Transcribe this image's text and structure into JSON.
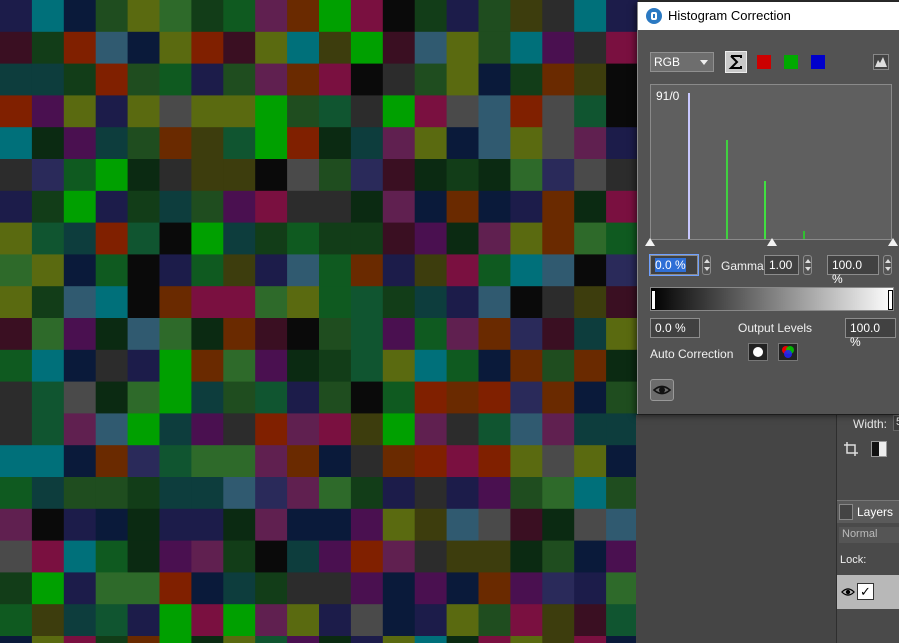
{
  "dialog": {
    "title": "Histogram Correction",
    "channel_select": "RGB",
    "channel_buttons": [
      "all-channels",
      "red",
      "green",
      "blue"
    ],
    "histogram_label": "91/0",
    "input_black": "0.0 %",
    "gamma_label": "Gamma:",
    "gamma_value": "1.00",
    "input_white": "100.0 %",
    "output_black": "0.0 %",
    "output_label": "Output Levels",
    "output_white": "100.0 %",
    "auto_label": "Auto Correction"
  },
  "side_panel": {
    "width_label": "Width:",
    "width_value": "5",
    "layers_tab": "Layers",
    "blend_mode": "Normal",
    "lock_label": "Lock:"
  },
  "colors": {
    "red": "#cc0000",
    "green": "#00aa00",
    "blue": "#0000cc",
    "dialog_bg": "#535353"
  }
}
